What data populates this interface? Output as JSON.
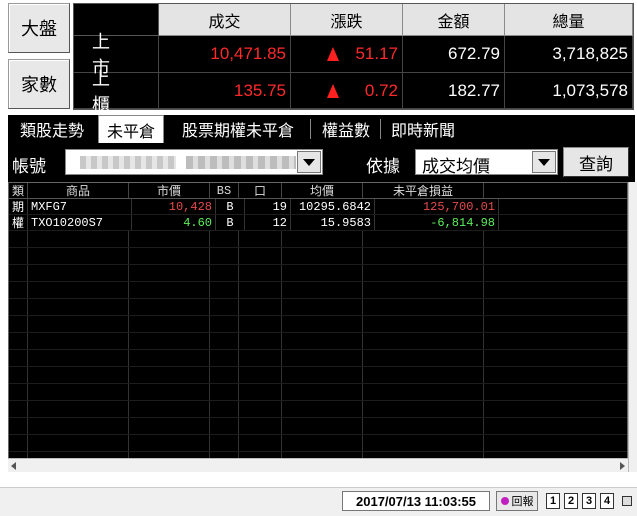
{
  "left_buttons": {
    "market": "大盤",
    "family": "家數"
  },
  "market": {
    "headers": [
      "成交",
      "漲跌",
      "金額",
      "總量"
    ],
    "rows": [
      {
        "label": "上市",
        "price": "10,471.85",
        "change": "51.17",
        "amount": "672.79",
        "volume": "3,718,825",
        "change_dir": "up"
      },
      {
        "label": "上櫃",
        "price": "135.75",
        "change": "0.72",
        "amount": "182.77",
        "volume": "1,073,578",
        "change_dir": "up"
      }
    ]
  },
  "tabs": [
    {
      "label": "類股走勢",
      "active": false
    },
    {
      "label": "未平倉",
      "active": true
    },
    {
      "label": "股票期權未平倉",
      "active": false
    },
    {
      "label": "權益數",
      "active": false
    },
    {
      "label": "即時新聞",
      "active": false
    }
  ],
  "filter": {
    "account_label": "帳號",
    "sort_label": "依據",
    "sort_value": "成交均價",
    "query_button": "查詢"
  },
  "table": {
    "columns": [
      "類",
      "商品",
      "市價",
      "BS",
      "口",
      "均價",
      "未平倉損益"
    ],
    "rows": [
      {
        "type": "期",
        "product": "MXFG7",
        "market_price": "10,428",
        "bs": "B",
        "lots": "19",
        "avg_price": "10295.6842",
        "pnl": "125,700.01",
        "pnl_sign": "positive"
      },
      {
        "type": "權",
        "product": "TXO10200S7",
        "market_price": "4.60",
        "bs": "B",
        "lots": "12",
        "avg_price": "15.9583",
        "pnl": "-6,814.98",
        "pnl_sign": "negative"
      }
    ]
  },
  "status": {
    "datetime": "2017/07/13 11:03:55",
    "report_button": "回報",
    "pages": [
      "1",
      "2",
      "3",
      "4"
    ]
  },
  "colors": {
    "up": "#ff2a2a",
    "positive": "#e64b4b",
    "negative": "#5cf05c"
  }
}
